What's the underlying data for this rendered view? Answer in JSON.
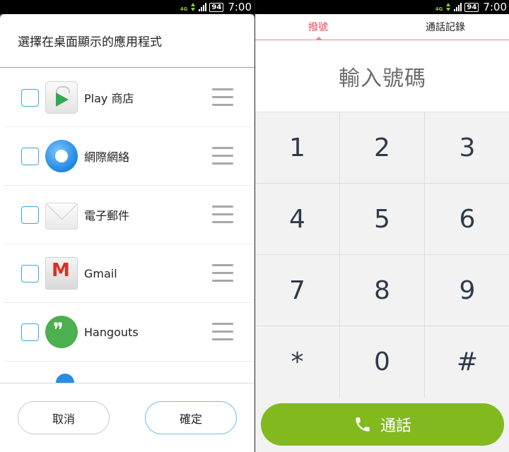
{
  "status_bar": {
    "network": "4G",
    "battery": "94",
    "time": "7:00"
  },
  "left_dialog": {
    "title": "選擇在桌面顯示的應用程式",
    "apps": [
      {
        "label": "Play 商店",
        "icon": "play-store-icon",
        "checked": false
      },
      {
        "label": "網際網絡",
        "icon": "browser-globe-icon",
        "checked": false
      },
      {
        "label": "電子郵件",
        "icon": "email-envelope-icon",
        "checked": false
      },
      {
        "label": "Gmail",
        "icon": "gmail-icon",
        "checked": false
      },
      {
        "label": "Hangouts",
        "icon": "hangouts-icon",
        "checked": false
      }
    ],
    "cancel_label": "取消",
    "confirm_label": "確定"
  },
  "dialer": {
    "tabs": [
      {
        "label": "撥號",
        "active": true
      },
      {
        "label": "通話記錄",
        "active": false
      }
    ],
    "placeholder": "輸入號碼",
    "keys": [
      "1",
      "2",
      "3",
      "4",
      "5",
      "6",
      "7",
      "8",
      "9",
      "*",
      "0",
      "#"
    ],
    "call_label": "通話",
    "accent_color": "#e24c55",
    "call_color": "#82b91f"
  }
}
